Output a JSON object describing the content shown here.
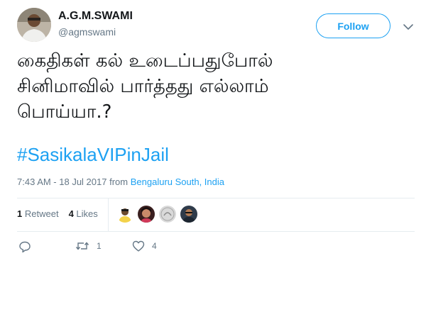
{
  "author": {
    "name": "A.G.M.SWAMI",
    "handle": "@agmswami"
  },
  "follow_label": "Follow",
  "tweet": {
    "lines": [
      "கைதிகள் கல் உடைப்பதுபோல்",
      "சினிமாவில் பார்த்தது எல்லாம்",
      "பொய்யா.?"
    ],
    "hashtag": "#SasikalaVIPinJail"
  },
  "meta": {
    "time": "7:43 AM - 18 Jul 2017",
    "from": "from",
    "location": "Bengaluru South, India"
  },
  "stats": {
    "retweets_count": "1",
    "retweets_label": "Retweet",
    "likes_count": "4",
    "likes_label": "Likes"
  },
  "actions": {
    "retweet_count": "1",
    "like_count": "4"
  },
  "colors": {
    "accent": "#1da1f2",
    "muted": "#657786",
    "text": "#14171a"
  },
  "icons": [
    "reply-icon",
    "retweet-icon",
    "like-icon",
    "chevron-down-icon"
  ]
}
